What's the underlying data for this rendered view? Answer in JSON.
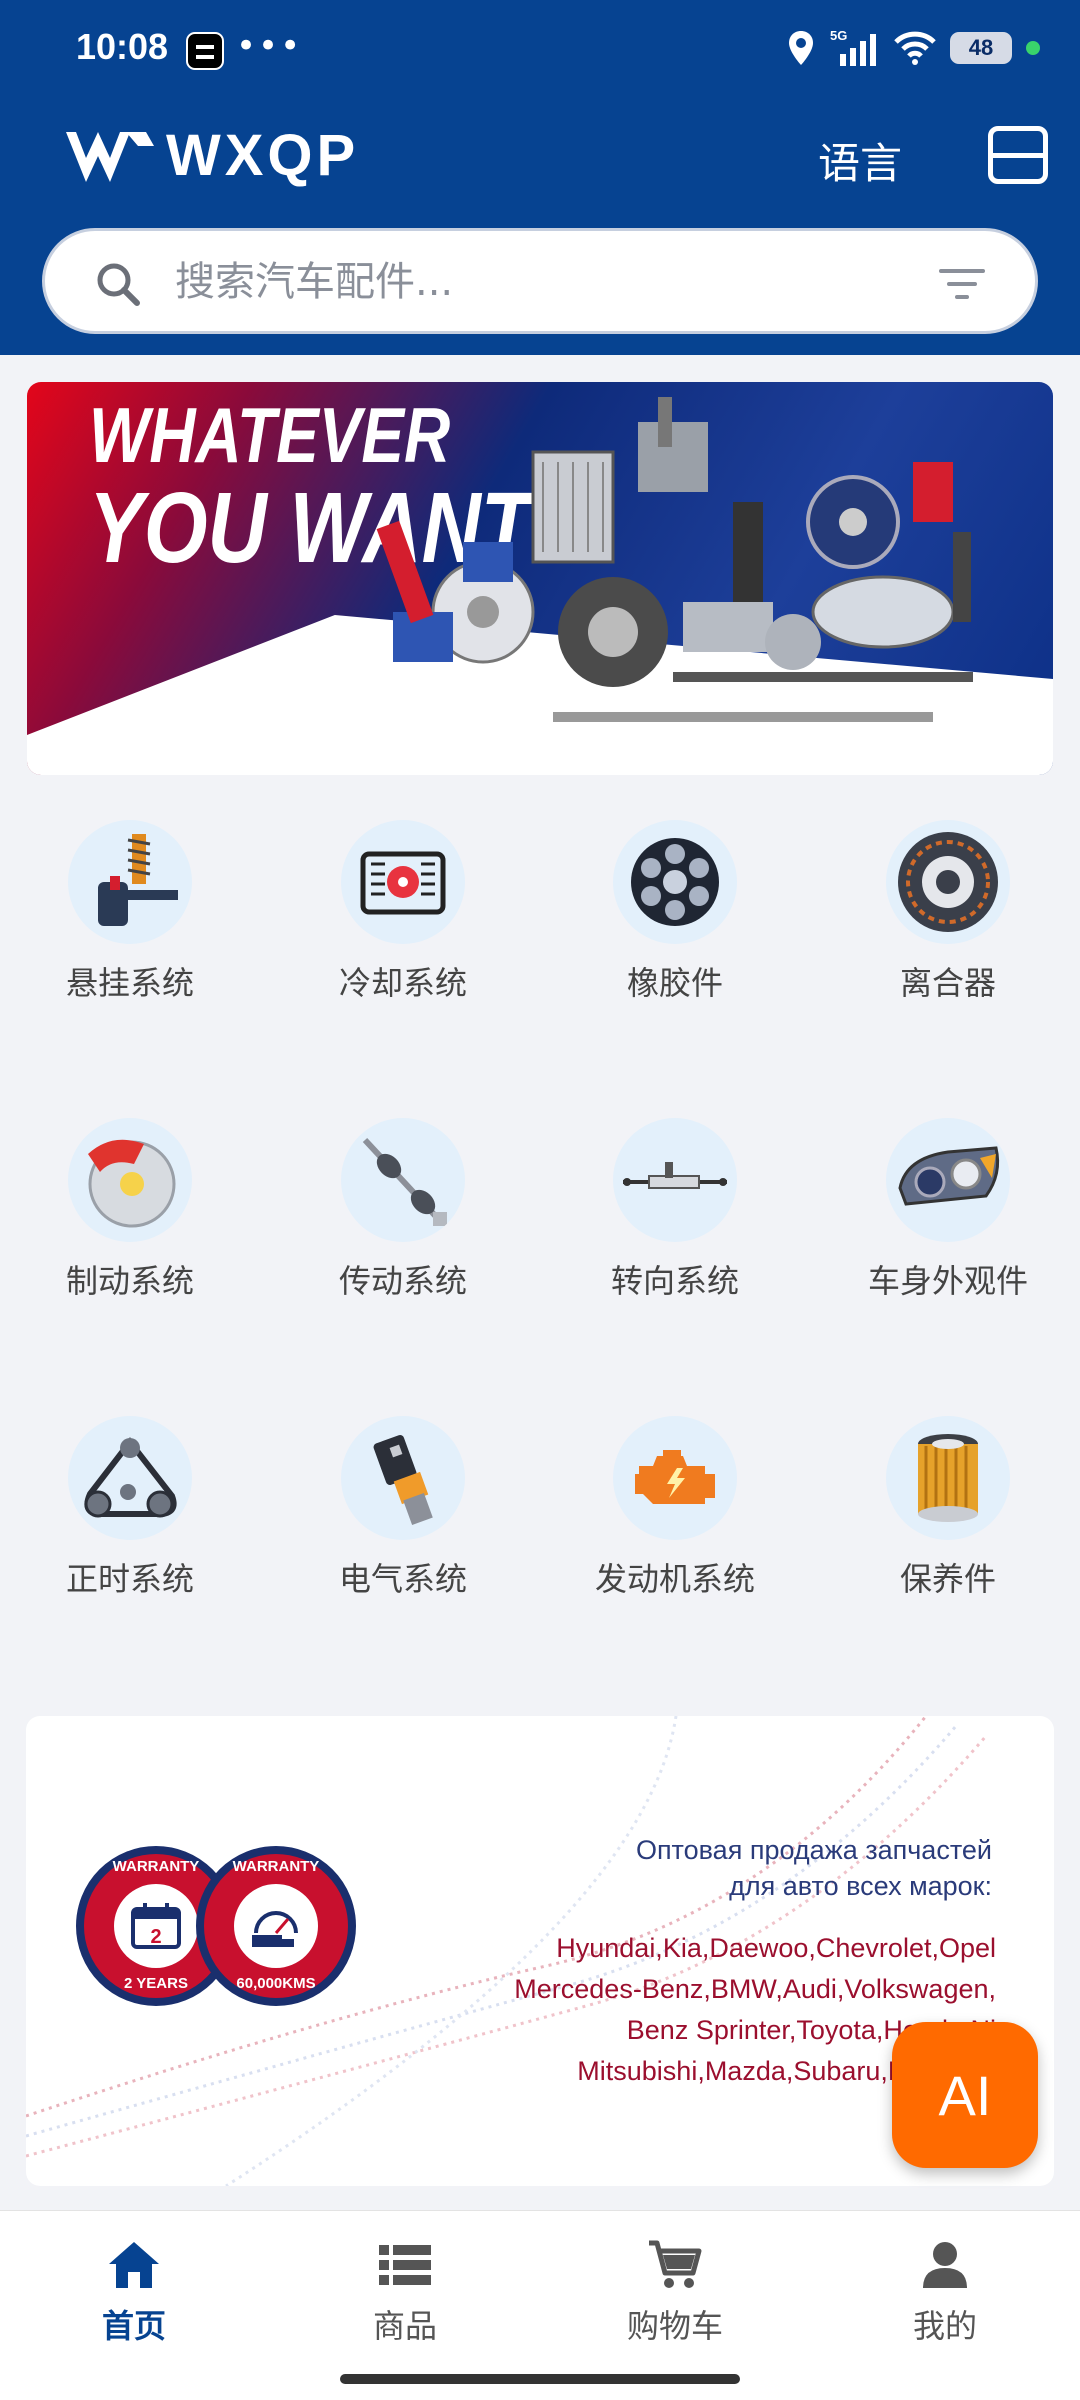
{
  "status_bar": {
    "time": "10:08",
    "battery": "48",
    "network": "5G"
  },
  "header": {
    "logo_text": "WXQP",
    "language_label": "语言"
  },
  "search": {
    "placeholder": "搜索汽车配件..."
  },
  "banner": {
    "line1": "WHATEVER",
    "line2": "YOU WANT"
  },
  "categories": [
    {
      "label": "悬挂系统",
      "icon": "suspension-icon"
    },
    {
      "label": "冷却系统",
      "icon": "cooling-icon"
    },
    {
      "label": "橡胶件",
      "icon": "rubber-part-icon"
    },
    {
      "label": "离合器",
      "icon": "clutch-icon"
    },
    {
      "label": "制动系统",
      "icon": "brake-icon"
    },
    {
      "label": "传动系统",
      "icon": "driveshaft-icon"
    },
    {
      "label": "转向系统",
      "icon": "steering-rack-icon"
    },
    {
      "label": "车身外观件",
      "icon": "headlight-icon"
    },
    {
      "label": "正时系统",
      "icon": "timing-belt-icon"
    },
    {
      "label": "电气系统",
      "icon": "sensor-icon"
    },
    {
      "label": "发动机系统",
      "icon": "engine-icon"
    },
    {
      "label": "保养件",
      "icon": "filter-icon"
    }
  ],
  "promo": {
    "badge1_top": "WARRANTY",
    "badge1_bottom": "2 YEARS",
    "badge2_top": "WARRANTY",
    "badge2_bottom": "60,000KMS",
    "ru_line1": "Оптовая продажа запчастей",
    "ru_line2": "для авто всех марок:",
    "brands_line1": "Hyundai,Kia,Daewoo,Chevrolet,Opel",
    "brands_line2": "Mercedes-Benz,BMW,Audi,Volkswagen,",
    "brands_line3": "Benz Sprinter,Toyota,Honda,Ni",
    "brands_line4": "Mitsubishi,Mazda,Subaru,Ford,Lad"
  },
  "ai_button": {
    "label": "AI"
  },
  "bottom_nav": [
    {
      "label": "首页",
      "active": true
    },
    {
      "label": "商品",
      "active": false
    },
    {
      "label": "购物车",
      "active": false
    },
    {
      "label": "我的",
      "active": false
    }
  ],
  "colors": {
    "primary": "#064391",
    "accent": "#ff6a00",
    "brand_red": "#c8102e"
  }
}
